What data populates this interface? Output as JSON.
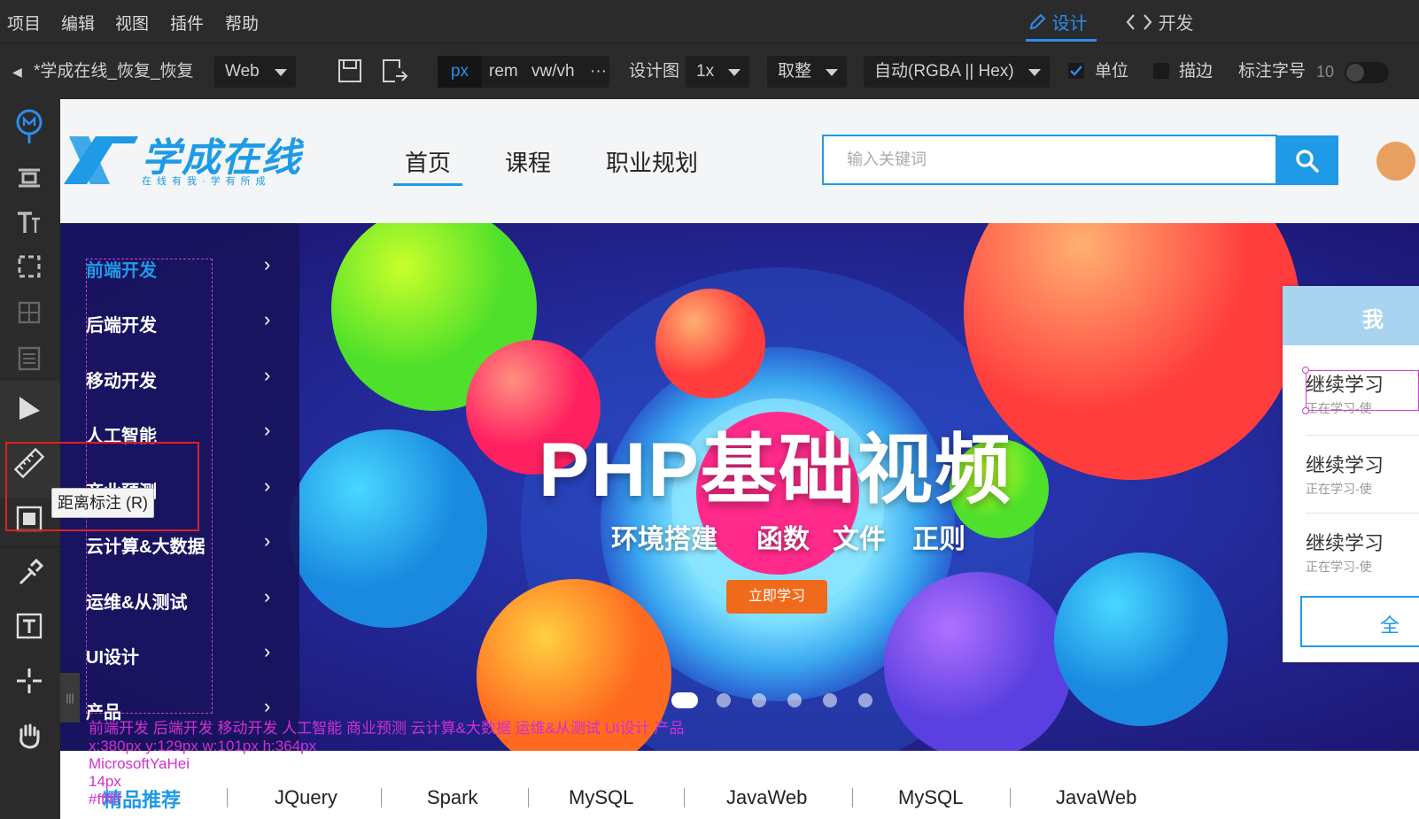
{
  "menu": {
    "items": [
      "项目",
      "编辑",
      "视图",
      "插件",
      "帮助"
    ],
    "modes": {
      "design": "设计",
      "dev": "开发"
    }
  },
  "toolbar": {
    "file_title": "*学成在线_恢复_恢复",
    "platform": "Web",
    "units": {
      "px": "px",
      "rem": "rem",
      "vw": "vw/vh",
      "more": "···"
    },
    "design_label": "设计图",
    "scale": "1x",
    "rounding": "取整",
    "color_format": "自动(RGBA || Hex)",
    "unit_label": "单位",
    "stroke_label": "描边",
    "font_size_label": "标注字号",
    "font_size_value": "10"
  },
  "tooltip": "距离标注 (R)",
  "site": {
    "logo": "学成在线",
    "logo_sub": "在线有我·学有所成",
    "nav": [
      "首页",
      "课程",
      "职业规划"
    ],
    "search_placeholder": "输入关键词"
  },
  "side_menu": [
    "前端开发",
    "后端开发",
    "移动开发",
    "人工智能",
    "商业预测",
    "云计算&大数据",
    "运维&从测试",
    "UI设计",
    "产品"
  ],
  "banner": {
    "title": "PHP基础视频",
    "subs": [
      "环境搭建",
      "函数",
      "文件",
      "正则"
    ],
    "cta": "立即学习"
  },
  "right_panel": {
    "head": "我",
    "rows": [
      {
        "title": "继续学习",
        "sub": "正在学习-使"
      },
      {
        "title": "继续学习",
        "sub": "正在学习-使"
      },
      {
        "title": "继续学习",
        "sub": "正在学习-使"
      }
    ],
    "button": "全"
  },
  "annotation": {
    "text": "前端开发 后端开发 移动开发 人工智能 商业预测 云计算&大数据 运维&从测试 UI设计 产品",
    "coords": "x:380px y:129px w:101px h:364px",
    "font": "MicrosoftYaHei",
    "size": "14px",
    "color": "#ffffff"
  },
  "strip": {
    "first": "精品推荐",
    "items": [
      "JQuery",
      "Spark",
      "MySQL",
      "JavaWeb",
      "MySQL",
      "JavaWeb"
    ]
  },
  "colors": {
    "accent": "#2d8cf0",
    "brand": "#1e9ae6",
    "highlight": "#e02020",
    "annotation": "#d030d0"
  }
}
